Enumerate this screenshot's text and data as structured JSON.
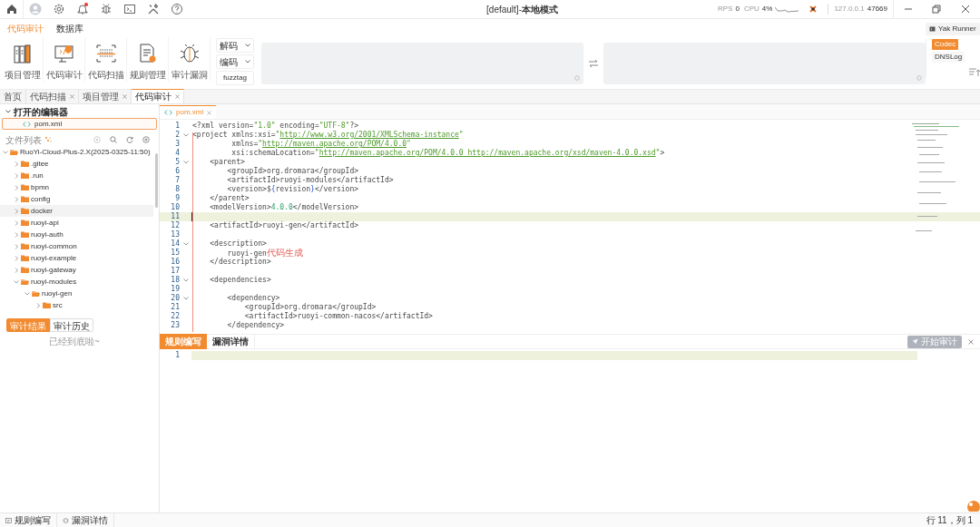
{
  "titlebar": {
    "title": "[default]-**本地模式**",
    "notification": true,
    "rps_label": "RPS",
    "rps": "0",
    "cpu_label": "CPU",
    "cpu": "4%",
    "host": "127.0.0.1",
    "port": "47669"
  },
  "ribbon": {
    "tabs": [
      {
        "label": "代码审计",
        "selected": true
      },
      {
        "label": "数据库",
        "selected": false
      }
    ],
    "tools": [
      {
        "label": "项目管理",
        "kind": "books"
      },
      {
        "label": "代码审计",
        "kind": "monitor"
      },
      {
        "label": "代码扫描",
        "kind": "scan"
      },
      {
        "label": "规则管理",
        "kind": "doc"
      },
      {
        "label": "审计漏洞",
        "kind": "bug"
      }
    ],
    "codec_selects": [
      "解码",
      "编码"
    ],
    "fuzztag_button": "fuzztag",
    "runner_button": "Yak Runner",
    "side_tabs": [
      {
        "label": "Codec",
        "selected": true
      },
      {
        "label": "DNSLog",
        "selected": false
      }
    ]
  },
  "page_tabs": [
    {
      "label": "首页",
      "closable": false,
      "selected": false
    },
    {
      "label": "代码扫描",
      "closable": true,
      "selected": false
    },
    {
      "label": "项目管理",
      "closable": true,
      "selected": false
    },
    {
      "label": "代码审计",
      "closable": true,
      "selected": true
    }
  ],
  "sidebar": {
    "open_editors": {
      "title": "打开的编辑器",
      "expanded": true,
      "items": [
        {
          "label": "pom.xml",
          "selected": true
        }
      ]
    },
    "file_list_title": "文件列表",
    "tree": [
      {
        "label": "RuoYi-Cloud-Plus-2.X(2025-0325-11:50)",
        "expanded": true,
        "selected": false,
        "children": [
          {
            "label": ".gitee",
            "expanded": false,
            "selected": false
          },
          {
            "label": ".run",
            "expanded": false,
            "selected": false
          },
          {
            "label": "bpmn",
            "expanded": false,
            "selected": false
          },
          {
            "label": "config",
            "expanded": false,
            "selected": false
          },
          {
            "label": "docker",
            "expanded": false,
            "selected": true
          },
          {
            "label": "ruoyi-api",
            "expanded": false,
            "selected": false
          },
          {
            "label": "ruoyi-auth",
            "expanded": false,
            "selected": false
          },
          {
            "label": "ruoyi-common",
            "expanded": false,
            "selected": false
          },
          {
            "label": "ruoyi-example",
            "expanded": false,
            "selected": false
          },
          {
            "label": "ruoyi-gateway",
            "expanded": false,
            "selected": false
          },
          {
            "label": "ruoyi-modules",
            "expanded": true,
            "selected": false,
            "children": [
              {
                "label": "ruoyi-gen",
                "expanded": true,
                "selected": false,
                "children": [
                  {
                    "label": "src",
                    "expanded": false,
                    "selected": false
                  }
                ]
              }
            ]
          }
        ]
      }
    ],
    "result_tabs": [
      {
        "label": "审计结果",
        "selected": true
      },
      {
        "label": "审计历史",
        "selected": false
      }
    ],
    "end_note": "已经到底啦~"
  },
  "editor": {
    "tab": "pom.xml",
    "lines": [
      {
        "n": "1",
        "fold": false,
        "current": false,
        "tokens": [
          {
            "t": "<?xml version=",
            "kind": "tag"
          },
          {
            "t": "\"1.0\"",
            "kind": "str"
          },
          {
            "t": " encoding=",
            "kind": "tag"
          },
          {
            "t": "\"UTF-8\"",
            "kind": "str"
          },
          {
            "t": "?>",
            "kind": "tag"
          }
        ]
      },
      {
        "n": "2",
        "fold": true,
        "current": false,
        "tokens": [
          {
            "t": "<project xmlns:xsi=",
            "kind": "tag"
          },
          {
            "t": "\"",
            "kind": "str"
          },
          {
            "t": "http://www.w3.org/2001/XMLSchema-instance",
            "kind": "url"
          },
          {
            "t": "\"",
            "kind": "str"
          }
        ]
      },
      {
        "n": "3",
        "fold": false,
        "current": false,
        "tokens": [
          {
            "t": "         xmlns=",
            "kind": "tag"
          },
          {
            "t": "\"",
            "kind": "str"
          },
          {
            "t": "http://maven.apache.org/POM/4.0.0",
            "kind": "url"
          },
          {
            "t": "\"",
            "kind": "str"
          }
        ]
      },
      {
        "n": "4",
        "fold": false,
        "current": false,
        "tokens": [
          {
            "t": "         xsi:schemaLocation=",
            "kind": "tag"
          },
          {
            "t": "\"",
            "kind": "str"
          },
          {
            "t": "http://maven.apache.org/POM/4.0.0 http://maven.apache.org/xsd/maven-4.0.0.xsd",
            "kind": "url"
          },
          {
            "t": "\"",
            "kind": "str"
          },
          {
            "t": ">",
            "kind": "tag"
          }
        ]
      },
      {
        "n": "5",
        "fold": true,
        "current": false,
        "tokens": [
          {
            "t": "    <parent>",
            "kind": "tag"
          }
        ]
      },
      {
        "n": "6",
        "fold": false,
        "current": false,
        "tokens": [
          {
            "t": "        <groupId>org.dromara</groupId>",
            "kind": "tag"
          }
        ]
      },
      {
        "n": "7",
        "fold": false,
        "current": false,
        "tokens": [
          {
            "t": "        <artifactId>ruoyi-modules</artifactId>",
            "kind": "tag"
          }
        ]
      },
      {
        "n": "8",
        "fold": false,
        "current": false,
        "tokens": [
          {
            "t": "        <version>$",
            "kind": "tag"
          },
          {
            "t": "{",
            "kind": "brace"
          },
          {
            "t": "revision",
            "kind": "tag"
          },
          {
            "t": "}",
            "kind": "brace"
          },
          {
            "t": "</version>",
            "kind": "tag"
          }
        ]
      },
      {
        "n": "9",
        "fold": false,
        "current": false,
        "tokens": [
          {
            "t": "    </parent>",
            "kind": "tag"
          }
        ]
      },
      {
        "n": "10",
        "fold": false,
        "current": false,
        "tokens": [
          {
            "t": "    <modelVersion>",
            "kind": "tag"
          },
          {
            "t": "4.0.0",
            "kind": "num"
          },
          {
            "t": "</modelVersion>",
            "kind": "tag"
          }
        ]
      },
      {
        "n": "11",
        "fold": false,
        "current": true
      },
      {
        "n": "12",
        "fold": false,
        "current": false,
        "tokens": [
          {
            "t": "    <artifactId>ruoyi-gen</artifactId>",
            "kind": "tag"
          }
        ]
      },
      {
        "n": "13",
        "fold": false,
        "current": false
      },
      {
        "n": "14",
        "fold": true,
        "current": false,
        "tokens": [
          {
            "t": "    <description>",
            "kind": "tag"
          }
        ]
      },
      {
        "n": "15",
        "fold": false,
        "current": false,
        "tokens": [
          {
            "t": "        ruoyi-gen",
            "kind": "tag"
          },
          {
            "t": "代码生成",
            "kind": "zh"
          }
        ]
      },
      {
        "n": "16",
        "fold": false,
        "current": false,
        "tokens": [
          {
            "t": "    </description>",
            "kind": "tag"
          }
        ]
      },
      {
        "n": "17",
        "fold": false,
        "current": false
      },
      {
        "n": "18",
        "fold": true,
        "current": false,
        "tokens": [
          {
            "t": "    <dependencies>",
            "kind": "tag"
          }
        ]
      },
      {
        "n": "19",
        "fold": false,
        "current": false
      },
      {
        "n": "20",
        "fold": true,
        "current": false,
        "tokens": [
          {
            "t": "        <dependency>",
            "kind": "tag"
          }
        ]
      },
      {
        "n": "21",
        "fold": false,
        "current": false,
        "tokens": [
          {
            "t": "            <groupId>org.dromara</groupId>",
            "kind": "tag"
          }
        ]
      },
      {
        "n": "22",
        "fold": false,
        "current": false,
        "tokens": [
          {
            "t": "            <artifactId>ruoyi-common-nacos</artifactId>",
            "kind": "tag"
          }
        ]
      },
      {
        "n": "23",
        "fold": false,
        "current": false,
        "tokens": [
          {
            "t": "        </dependency>",
            "kind": "tag"
          }
        ]
      }
    ]
  },
  "rule_panel": {
    "tabs": [
      {
        "label": "规则编写",
        "selected": true
      },
      {
        "label": "漏洞详情",
        "selected": false
      }
    ],
    "start_button": {
      "label": "开始审计",
      "disabled": true
    },
    "line": "1"
  },
  "status_bar": {
    "items": [
      {
        "label": "规则编写",
        "kind": "rule"
      },
      {
        "label": "漏洞详情",
        "kind": "bug"
      }
    ],
    "position": "行 11，列 1"
  }
}
